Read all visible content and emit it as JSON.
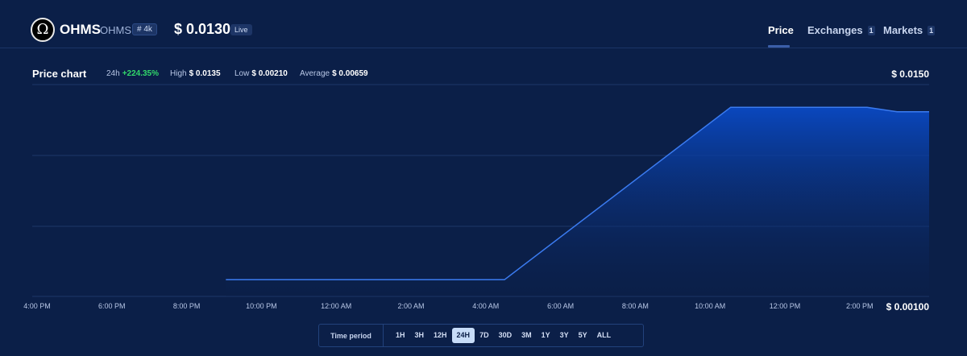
{
  "header": {
    "token_name": "OHMS",
    "token_symbol": "OHMS",
    "rank": "# 4k",
    "price": "$ 0.0130",
    "live_label": "Live",
    "logo_glyph": "Ω",
    "tabs": [
      {
        "label": "Price",
        "count": null,
        "active": true
      },
      {
        "label": "Exchanges",
        "count": "1",
        "active": false
      },
      {
        "label": "Markets",
        "count": "1",
        "active": false
      }
    ]
  },
  "stats": {
    "title": "Price chart",
    "change_label": "24h",
    "change_value": "+224.35%",
    "high_label": "High",
    "high_value": "$ 0.0135",
    "low_label": "Low",
    "low_value": "$ 0.00210",
    "average_label": "Average",
    "average_value": "$ 0.00659"
  },
  "chart_labels": {
    "max": "$ 0.0150",
    "min": "$ 0.00100"
  },
  "chart_data": {
    "type": "area",
    "x_ticks": [
      "4:00 PM",
      "6:00 PM",
      "8:00 PM",
      "10:00 PM",
      "12:00 AM",
      "2:00 AM",
      "4:00 AM",
      "6:00 AM",
      "8:00 AM",
      "10:00 AM",
      "12:00 PM",
      "2:00 PM"
    ],
    "x_start_hour": 16,
    "ylim": [
      0.001,
      0.015
    ],
    "series": [
      {
        "x": [
          21.05,
          28.5,
          34.55,
          38.2,
          39.0,
          40.2
        ],
        "values": [
          0.0021,
          0.0021,
          0.0135,
          0.0135,
          0.0132,
          0.0132
        ]
      }
    ],
    "colors": {
      "line": "#3b7bf0",
      "fill_top": "#0a49c4",
      "fill_bottom": "#0b1f48"
    }
  },
  "time_period": {
    "label": "Time period",
    "options": [
      "1H",
      "3H",
      "12H",
      "24H",
      "7D",
      "30D",
      "3M",
      "1Y",
      "3Y",
      "5Y",
      "ALL"
    ],
    "selected": "24H"
  }
}
